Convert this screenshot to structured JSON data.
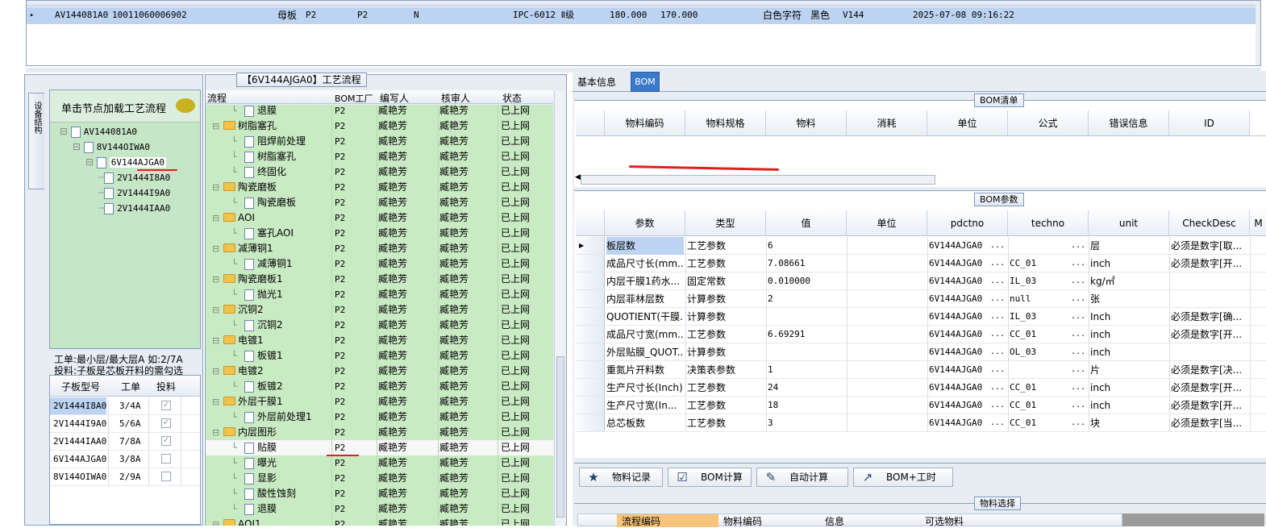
{
  "top_row": {
    "marker": "▸",
    "c1": "AV144081A0",
    "c2": "10011060006902",
    "c3": "母板",
    "c4": "P2",
    "c5": "P2",
    "c6": "N",
    "c7": "IPC-6012 Ⅱ级",
    "c8": "180.000",
    "c9": "170.000",
    "c10": "白色字符",
    "c11": "黑色",
    "c12": "V144",
    "c13": "2025-07-08 09:16:22"
  },
  "left_panel": {
    "vertical_tab": "设备结构",
    "title": "单击节点加载工艺流程",
    "tree": [
      "AV144081A0",
      "8V144OIWA0",
      "6V144AJGA0",
      "2V1444I8A0",
      "2V1444I9A0",
      "2V1444IAA0"
    ],
    "hint1": "工单:最小层/最大层A 如:2/7A",
    "hint2": "投料:子板是芯板开料的需勾选",
    "sub_headers": [
      "子板型号",
      "工单",
      "投料"
    ],
    "sub_rows": [
      {
        "model": "2V1444I8A0",
        "order": "3/4A",
        "feed": true
      },
      {
        "model": "2V1444I9A0",
        "order": "5/6A",
        "feed": true
      },
      {
        "model": "2V1444IAA0",
        "order": "7/8A",
        "feed": true
      },
      {
        "model": "6V144AJGA0",
        "order": "3/8A",
        "feed": false
      },
      {
        "model": "8V144OIWA0",
        "order": "2/9A",
        "feed": false
      }
    ]
  },
  "flow_panel": {
    "title": "【6V144AJGA0】工艺流程",
    "headers": [
      "流程",
      "BOM工厂",
      "编写人",
      "核审人",
      "状态"
    ],
    "rows": [
      {
        "name": "退膜",
        "level": 2,
        "factory": "P2",
        "writer": "臧艳芳",
        "reviewer": "臧艳芳",
        "status": "已上网"
      },
      {
        "name": "树脂塞孔",
        "level": 1,
        "factory": "P2",
        "writer": "臧艳芳",
        "reviewer": "臧艳芳",
        "status": "已上网"
      },
      {
        "name": "阻焊前处理",
        "level": 2,
        "factory": "P2",
        "writer": "臧艳芳",
        "reviewer": "臧艳芳",
        "status": "已上网"
      },
      {
        "name": "树脂塞孔",
        "level": 2,
        "factory": "P2",
        "writer": "臧艳芳",
        "reviewer": "臧艳芳",
        "status": "已上网"
      },
      {
        "name": "终固化",
        "level": 2,
        "factory": "P2",
        "writer": "臧艳芳",
        "reviewer": "臧艳芳",
        "status": "已上网"
      },
      {
        "name": "陶瓷磨板",
        "level": 1,
        "factory": "P2",
        "writer": "臧艳芳",
        "reviewer": "臧艳芳",
        "status": "已上网"
      },
      {
        "name": "陶瓷磨板",
        "level": 2,
        "factory": "P2",
        "writer": "臧艳芳",
        "reviewer": "臧艳芳",
        "status": "已上网"
      },
      {
        "name": "AOI",
        "level": 1,
        "factory": "P2",
        "writer": "臧艳芳",
        "reviewer": "臧艳芳",
        "status": "已上网"
      },
      {
        "name": "塞孔AOI",
        "level": 2,
        "factory": "P2",
        "writer": "臧艳芳",
        "reviewer": "臧艳芳",
        "status": "已上网"
      },
      {
        "name": "减薄铜1",
        "level": 1,
        "factory": "P2",
        "writer": "臧艳芳",
        "reviewer": "臧艳芳",
        "status": "已上网"
      },
      {
        "name": "减薄铜1",
        "level": 2,
        "factory": "P2",
        "writer": "臧艳芳",
        "reviewer": "臧艳芳",
        "status": "已上网"
      },
      {
        "name": "陶瓷磨板1",
        "level": 1,
        "factory": "P2",
        "writer": "臧艳芳",
        "reviewer": "臧艳芳",
        "status": "已上网"
      },
      {
        "name": "抛光1",
        "level": 2,
        "factory": "P2",
        "writer": "臧艳芳",
        "reviewer": "臧艳芳",
        "status": "已上网"
      },
      {
        "name": "沉铜2",
        "level": 1,
        "factory": "P2",
        "writer": "臧艳芳",
        "reviewer": "臧艳芳",
        "status": "已上网"
      },
      {
        "name": "沉铜2",
        "level": 2,
        "factory": "P2",
        "writer": "臧艳芳",
        "reviewer": "臧艳芳",
        "status": "已上网"
      },
      {
        "name": "电镀1",
        "level": 1,
        "factory": "P2",
        "writer": "臧艳芳",
        "reviewer": "臧艳芳",
        "status": "已上网"
      },
      {
        "name": "板镀1",
        "level": 2,
        "factory": "P2",
        "writer": "臧艳芳",
        "reviewer": "臧艳芳",
        "status": "已上网"
      },
      {
        "name": "电镀2",
        "level": 1,
        "factory": "P2",
        "writer": "臧艳芳",
        "reviewer": "臧艳芳",
        "status": "已上网"
      },
      {
        "name": "板镀2",
        "level": 2,
        "factory": "P2",
        "writer": "臧艳芳",
        "reviewer": "臧艳芳",
        "status": "已上网"
      },
      {
        "name": "外层干膜1",
        "level": 1,
        "factory": "P2",
        "writer": "臧艳芳",
        "reviewer": "臧艳芳",
        "status": "已上网"
      },
      {
        "name": "外层前处理1",
        "level": 2,
        "factory": "P2",
        "writer": "臧艳芳",
        "reviewer": "臧艳芳",
        "status": "已上网"
      },
      {
        "name": "内层图形",
        "level": 1,
        "factory": "P2",
        "writer": "臧艳芳",
        "reviewer": "臧艳芳",
        "status": "已上网"
      },
      {
        "name": "贴膜",
        "level": 2,
        "factory": "P2",
        "writer": "臧艳芳",
        "reviewer": "臧艳芳",
        "status": "已上网",
        "selected": true
      },
      {
        "name": "曝光",
        "level": 2,
        "factory": "P2",
        "writer": "臧艳芳",
        "reviewer": "臧艳芳",
        "status": "已上网"
      },
      {
        "name": "显影",
        "level": 2,
        "factory": "P2",
        "writer": "臧艳芳",
        "reviewer": "臧艳芳",
        "status": "已上网"
      },
      {
        "name": "酸性蚀刻",
        "level": 2,
        "factory": "P2",
        "writer": "臧艳芳",
        "reviewer": "臧艳芳",
        "status": "已上网"
      },
      {
        "name": "退膜",
        "level": 2,
        "factory": "P2",
        "writer": "臧艳芳",
        "reviewer": "臧艳芳",
        "status": "已上网"
      },
      {
        "name": "AOI1",
        "level": 1,
        "factory": "P2",
        "writer": "臧艳芳",
        "reviewer": "臧艳芳",
        "status": "已上网"
      }
    ]
  },
  "right_panel": {
    "tabs": [
      "基本信息",
      "BOM"
    ],
    "bom_list_title": "BOM清单",
    "bom_list_headers": [
      "物料编码",
      "物料规格",
      "物料",
      "消耗",
      "单位",
      "公式",
      "错误信息",
      "ID"
    ],
    "bom_param_title": "BOM参数",
    "param_headers": [
      "参数",
      "类型",
      "值",
      "单位",
      "pdctno",
      "techno",
      "unit",
      "CheckDesc",
      "M"
    ],
    "param_rows": [
      {
        "param": "板层数",
        "type": "工艺参数",
        "value": "6",
        "unit_col": "",
        "pdctno": "6V144AJGA0",
        "techno": "",
        "unit": "层",
        "check": "必须是数字[取..."
      },
      {
        "param": "成品尺寸长(mm...",
        "type": "工艺参数",
        "value": "7.08661",
        "unit_col": "",
        "pdctno": "6V144AJGA0",
        "techno": "CC_01",
        "unit": "inch",
        "check": "必须是数字[开..."
      },
      {
        "param": "内层干膜1药水...",
        "type": "固定常数",
        "value": "0.010000",
        "unit_col": "",
        "pdctno": "6V144AJGA0",
        "techno": "IL_03",
        "unit": "kg/㎡",
        "check": ""
      },
      {
        "param": "内层菲林层数",
        "type": "计算参数",
        "value": "2",
        "unit_col": "",
        "pdctno": "6V144AJGA0",
        "techno": "null",
        "unit": "张",
        "check": ""
      },
      {
        "param": "QUOTIENT(干膜...",
        "type": "计算参数",
        "value": "",
        "unit_col": "",
        "pdctno": "6V144AJGA0",
        "techno": "IL_03",
        "unit": "Inch",
        "check": "必须是数字[确..."
      },
      {
        "param": "成品尺寸宽(mm...",
        "type": "工艺参数",
        "value": "6.69291",
        "unit_col": "",
        "pdctno": "6V144AJGA0",
        "techno": "CC_01",
        "unit": "inch",
        "check": "必须是数字[开..."
      },
      {
        "param": "外层贴膜_QUOT...",
        "type": "计算参数",
        "value": "",
        "unit_col": "",
        "pdctno": "6V144AJGA0",
        "techno": "OL_03",
        "unit": "inch",
        "check": ""
      },
      {
        "param": "重氮片开料数",
        "type": "决策表参数",
        "value": "1",
        "unit_col": "",
        "pdctno": "6V144AJGA0",
        "techno": "",
        "unit": "片",
        "check": "必须是数字[决..."
      },
      {
        "param": "生产尺寸长(Inch)",
        "type": "工艺参数",
        "value": "24",
        "unit_col": "",
        "pdctno": "6V144AJGA0",
        "techno": "CC_01",
        "unit": "inch",
        "check": "必须是数字[开..."
      },
      {
        "param": "生产尺寸宽(In...",
        "type": "工艺参数",
        "value": "18",
        "unit_col": "",
        "pdctno": "6V144AJGA0",
        "techno": "CC_01",
        "unit": "inch",
        "check": "必须是数字[开..."
      },
      {
        "param": "总芯板数",
        "type": "工艺参数",
        "value": "3",
        "unit_col": "",
        "pdctno": "6V144AJGA0",
        "techno": "CC_01",
        "unit": "块",
        "check": "必须是数字[当..."
      }
    ],
    "buttons": [
      "物料记录",
      "BOM计算",
      "自动计算",
      "BOM+工时"
    ],
    "material_title": "物料选择",
    "material_headers": [
      "流程编码",
      "物料编码",
      "信息",
      "可选物料"
    ]
  },
  "colors": {
    "selected_row": "#bcd3f2",
    "panel_green": "#c6e6c8",
    "flow_green": "#c9ebc3",
    "accent_red": "#e02020"
  }
}
